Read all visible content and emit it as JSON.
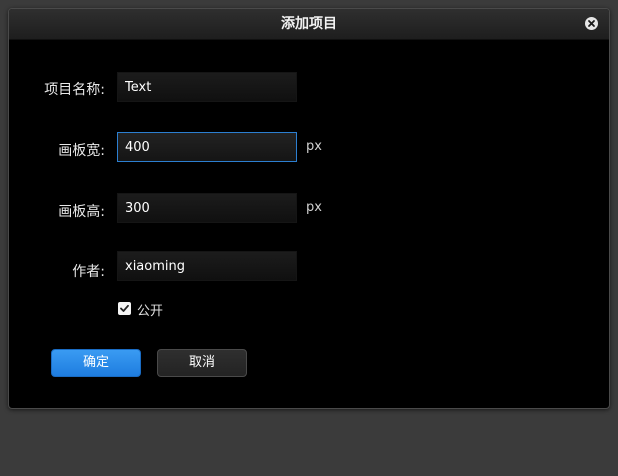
{
  "dialog": {
    "title": "添加项目",
    "close_icon": "close-icon"
  },
  "form": {
    "name": {
      "label": "项目名称:",
      "value": "Text"
    },
    "width": {
      "label": "画板宽:",
      "value": "400",
      "unit": "px"
    },
    "height": {
      "label": "画板高:",
      "value": "300",
      "unit": "px"
    },
    "author": {
      "label": "作者:",
      "value": "xiaoming"
    },
    "public": {
      "label": "公开",
      "checked": true
    }
  },
  "buttons": {
    "confirm": "确定",
    "cancel": "取消"
  },
  "colors": {
    "accent": "#1e7de0",
    "focus_border": "#2c7fd1",
    "dialog_bg": "#000000",
    "backdrop": "#3b3b3b"
  }
}
